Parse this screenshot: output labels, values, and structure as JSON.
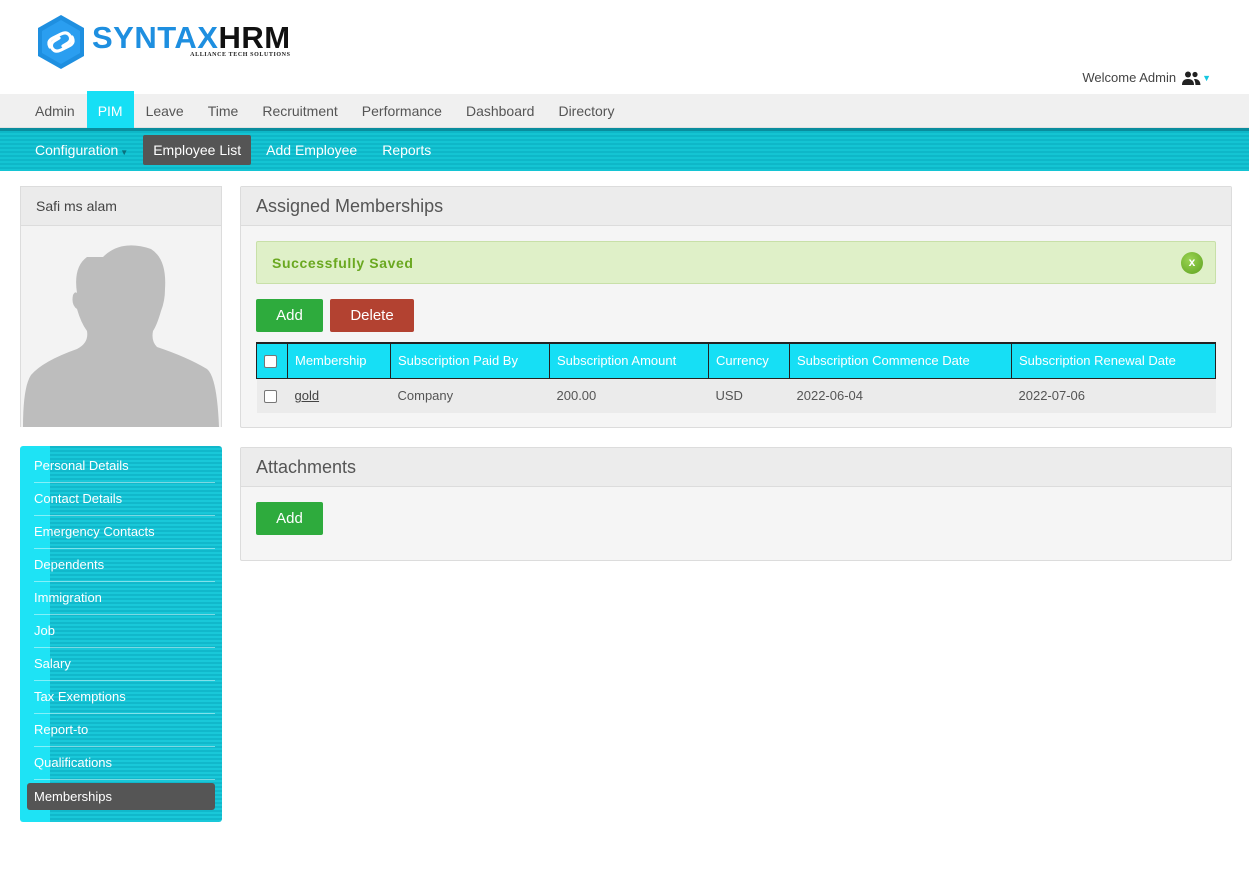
{
  "brand": {
    "name_part1": "SYNTAX",
    "name_part2": "HRM",
    "tagline": "ALLIANCE TECH SOLUTIONS",
    "colors": {
      "hex": "#1e8fe0",
      "accent": "#16dff5"
    }
  },
  "user": {
    "welcome": "Welcome Admin",
    "icon": "users-icon"
  },
  "main_nav": {
    "items": [
      {
        "label": "Admin",
        "active": false
      },
      {
        "label": "PIM",
        "active": true
      },
      {
        "label": "Leave",
        "active": false
      },
      {
        "label": "Time",
        "active": false
      },
      {
        "label": "Recruitment",
        "active": false
      },
      {
        "label": "Performance",
        "active": false
      },
      {
        "label": "Dashboard",
        "active": false
      },
      {
        "label": "Directory",
        "active": false
      }
    ]
  },
  "sub_nav": {
    "items": [
      {
        "label": "Configuration",
        "dropdown": true
      },
      {
        "label": "Employee List",
        "active": true
      },
      {
        "label": "Add Employee"
      },
      {
        "label": "Reports"
      }
    ]
  },
  "employee": {
    "name": "Safi ms alam"
  },
  "side_menu": {
    "items": [
      "Personal Details",
      "Contact Details",
      "Emergency Contacts",
      "Dependents",
      "Immigration",
      "Job",
      "Salary",
      "Tax Exemptions",
      "Report-to",
      "Qualifications",
      "Memberships"
    ],
    "active": "Memberships"
  },
  "memberships": {
    "title": "Assigned Memberships",
    "alert": "Successfully Saved",
    "alert_close": "x",
    "add_label": "Add",
    "delete_label": "Delete",
    "columns": [
      "Membership",
      "Subscription Paid By",
      "Subscription Amount",
      "Currency",
      "Subscription Commence Date",
      "Subscription Renewal Date"
    ],
    "rows": [
      {
        "membership": "gold",
        "paid_by": "Company",
        "amount": "200.00",
        "currency": "USD",
        "commence": "2022-06-04",
        "renewal": "2022-07-06"
      }
    ]
  },
  "attachments": {
    "title": "Attachments",
    "add_label": "Add"
  }
}
